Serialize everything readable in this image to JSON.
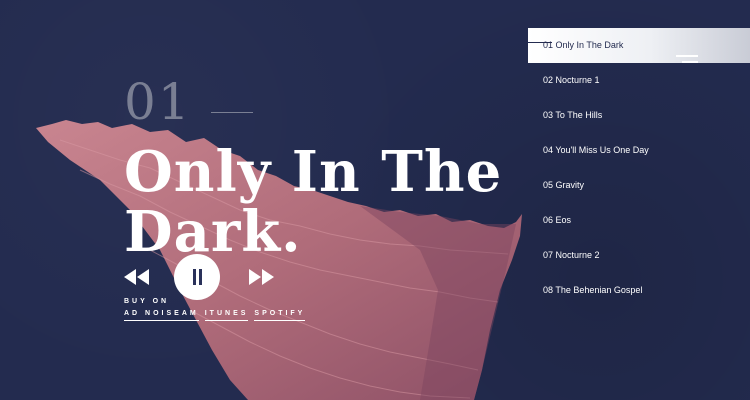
{
  "player": {
    "track_number": "01",
    "track_title": "Only In The Dark.",
    "prev_icon": "rewind-icon",
    "play_icon": "pause-icon",
    "next_icon": "fast-forward-icon"
  },
  "buy": {
    "label": "BUY ON",
    "stores": [
      "AD NOISEAM",
      "ITUNES",
      "SPOTIFY"
    ]
  },
  "tracklist": [
    "01 Only In The Dark",
    "02 Nocturne 1",
    "03 To The Hills",
    "04 You'll Miss Us One Day",
    "05 Gravity",
    "06 Eos",
    "07 Nocturne 2",
    "08 The Behenian Gospel"
  ],
  "active_track_index": 0,
  "menu_icon": "hamburger-menu-icon",
  "colors": {
    "background": "#232b4f",
    "terrain": "#b8727f",
    "text": "#ffffff",
    "muted_number": "#7a7f93"
  }
}
